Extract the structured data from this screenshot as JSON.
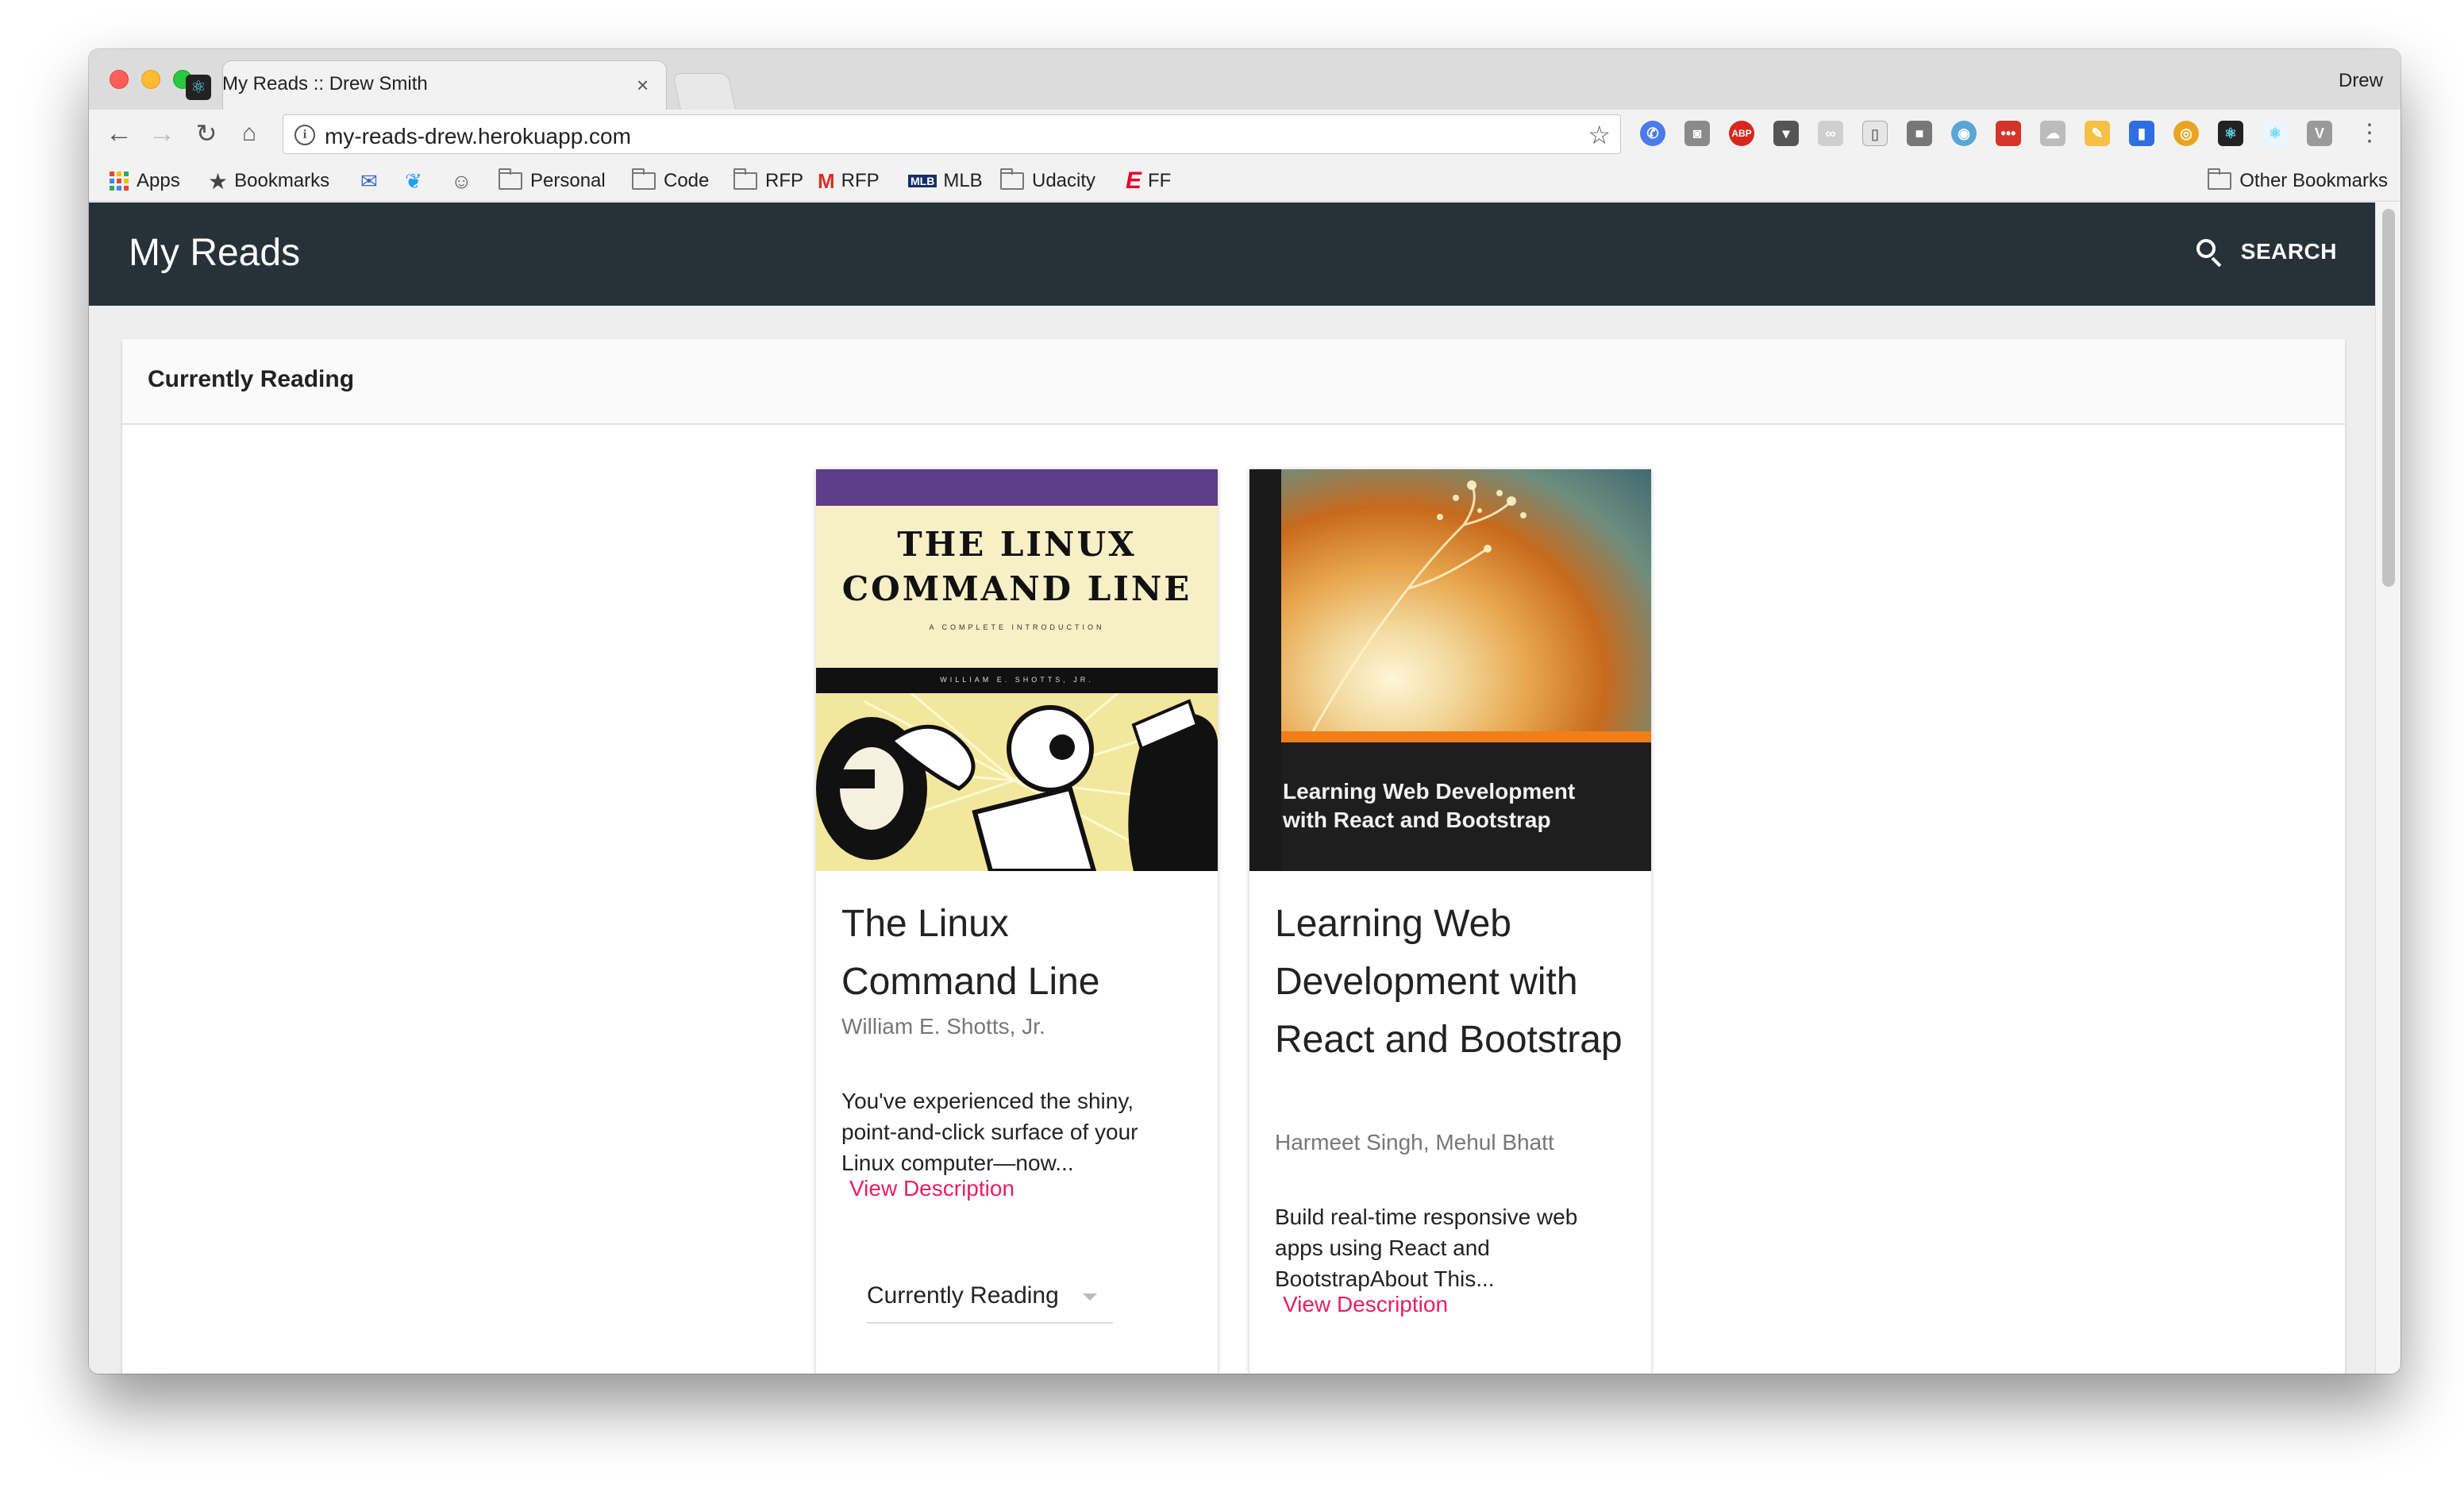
{
  "browser": {
    "tab_title": "My Reads :: Drew Smith",
    "profile_name": "Drew",
    "url": "my-reads-drew.herokuapp.com",
    "bookmarks": [
      "Apps",
      "Bookmarks",
      "Personal",
      "Code",
      "RFP",
      "RFP",
      "MLB",
      "Udacity",
      "FF"
    ],
    "other_bookmarks": "Other Bookmarks"
  },
  "app": {
    "title": "My Reads",
    "search_label": "SEARCH"
  },
  "shelf": {
    "title": "Currently Reading"
  },
  "books": [
    {
      "title": "The Linux Command Line",
      "authors": "William E. Shotts, Jr.",
      "description": "You've experienced the shiny, point-and-click surface of your Linux computer—now...",
      "view_description": "View Description",
      "shelf_value": "Currently Reading",
      "cover": {
        "line1": "THE LINUX",
        "line2": "COMMAND LINE",
        "subtitle": "A COMPLETE INTRODUCTION",
        "author": "WILLIAM E. SHOTTS, JR."
      }
    },
    {
      "title": "Learning Web Development with React and Bootstrap",
      "authors": "Harmeet Singh, Mehul Bhatt",
      "description": "Build real-time responsive web apps using React and BootstrapAbout This...",
      "view_description": "View Description",
      "cover": {
        "line1": "Learning Web Development",
        "line2": "with React and Bootstrap"
      }
    }
  ],
  "colors": {
    "appbar": "#263238",
    "accent_pink": "#e91e63",
    "page_bg": "#eeeeee"
  }
}
